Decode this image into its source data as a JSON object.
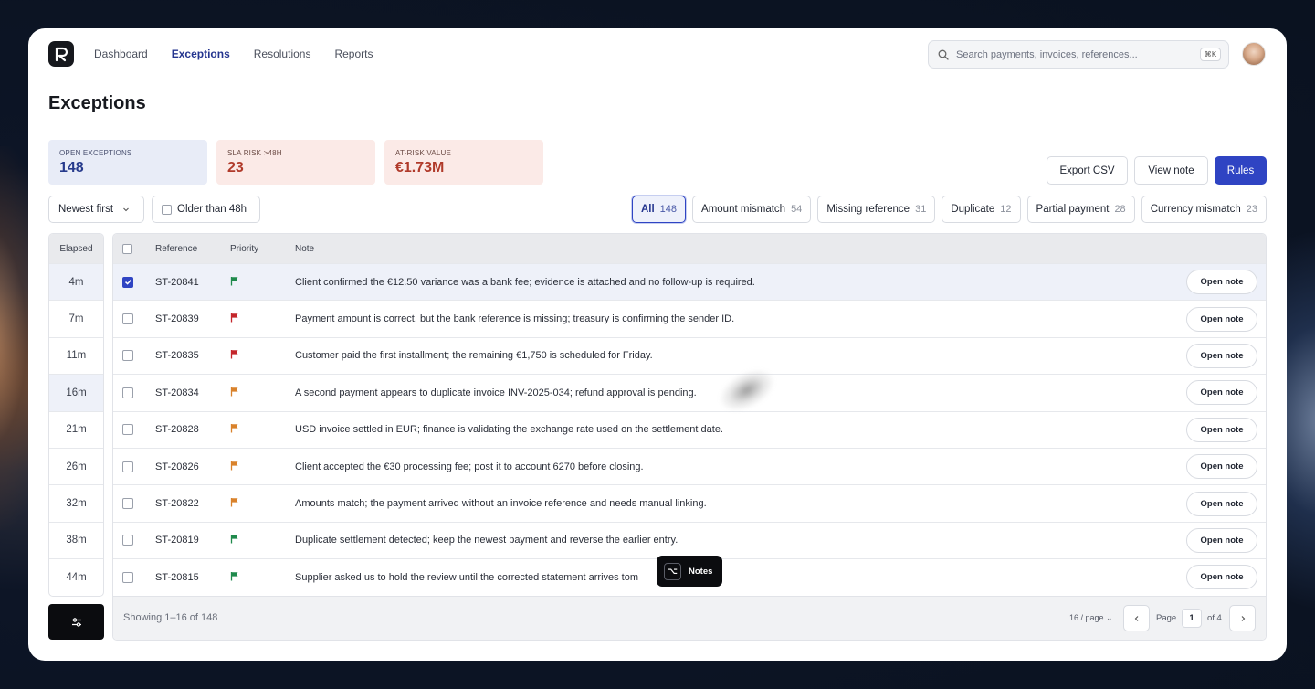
{
  "nav": {
    "items": [
      {
        "label": "Dashboard",
        "active": false
      },
      {
        "label": "Exceptions",
        "active": true
      },
      {
        "label": "Resolutions",
        "active": false
      },
      {
        "label": "Reports",
        "active": false
      }
    ]
  },
  "search": {
    "placeholder": "Search payments, invoices, references...",
    "shortcut": "⌘K"
  },
  "page": {
    "title": "Exceptions"
  },
  "stats": [
    {
      "label": "OPEN EXCEPTIONS",
      "value": "148"
    },
    {
      "label": "SLA RISK >48H",
      "value": "23"
    },
    {
      "label": "AT-RISK VALUE",
      "value": "€1.73M"
    }
  ],
  "actions": {
    "export": "Export CSV",
    "view_note": "View note",
    "rules": "Rules"
  },
  "filters": {
    "sort": "Newest first",
    "older": "Older than 48h",
    "chips": [
      {
        "label": "All",
        "count": "148",
        "active": true
      },
      {
        "label": "Amount mismatch",
        "count": "54",
        "active": false
      },
      {
        "label": "Missing reference",
        "count": "31",
        "active": false
      },
      {
        "label": "Duplicate",
        "count": "12",
        "active": false
      },
      {
        "label": "Partial payment",
        "count": "28",
        "active": false
      },
      {
        "label": "Currency mismatch",
        "count": "23",
        "active": false
      }
    ]
  },
  "table": {
    "elapsed_header": "Elapsed",
    "headers": {
      "reference": "Reference",
      "priority": "Priority",
      "note": "Note"
    },
    "action_label": "Open note",
    "rows": [
      {
        "elapsed": "4m",
        "reference": "ST-20841",
        "priority": "green",
        "note": "Client confirmed the €12.50 variance was a bank fee; evidence is attached and no follow-up is required.",
        "checked": true
      },
      {
        "elapsed": "7m",
        "reference": "ST-20839",
        "priority": "red",
        "note": "Payment amount is correct, but the bank reference is missing; treasury is confirming the sender ID.",
        "checked": false
      },
      {
        "elapsed": "11m",
        "reference": "ST-20835",
        "priority": "red",
        "note": "Customer paid the first installment; the remaining €1,750 is scheduled for Friday.",
        "checked": false
      },
      {
        "elapsed": "16m",
        "reference": "ST-20834",
        "priority": "orange",
        "note": "A second payment appears to duplicate invoice INV-2025-034; refund approval is pending.",
        "checked": false
      },
      {
        "elapsed": "21m",
        "reference": "ST-20828",
        "priority": "orange",
        "note": "USD invoice settled in EUR; finance is validating the exchange rate used on the settlement date.",
        "checked": false
      },
      {
        "elapsed": "26m",
        "reference": "ST-20826",
        "priority": "orange",
        "note": "Client accepted the €30 processing fee; post it to account 6270 before closing.",
        "checked": false
      },
      {
        "elapsed": "32m",
        "reference": "ST-20822",
        "priority": "orange",
        "note": "Amounts match; the payment arrived without an invoice reference and needs manual linking.",
        "checked": false
      },
      {
        "elapsed": "38m",
        "reference": "ST-20819",
        "priority": "green",
        "note": "Duplicate settlement detected; keep the newest payment and reverse the earlier entry.",
        "checked": false
      },
      {
        "elapsed": "44m",
        "reference": "ST-20815",
        "priority": "green",
        "note": "Supplier asked us to hold the review until the corrected statement arrives tom",
        "checked": false
      }
    ]
  },
  "footer": {
    "showing": "Showing 1–16 of 148",
    "per_page": "16 / page ⌄",
    "page_label": "Page",
    "page_current": "1",
    "page_of": "of 4"
  },
  "tooltip": {
    "label": "Notes",
    "key_symbol": "⌥"
  },
  "colors": {
    "accent": "#2f44c3",
    "green": "#1f8a4c",
    "red": "#c4262b",
    "orange": "#d9822b"
  }
}
